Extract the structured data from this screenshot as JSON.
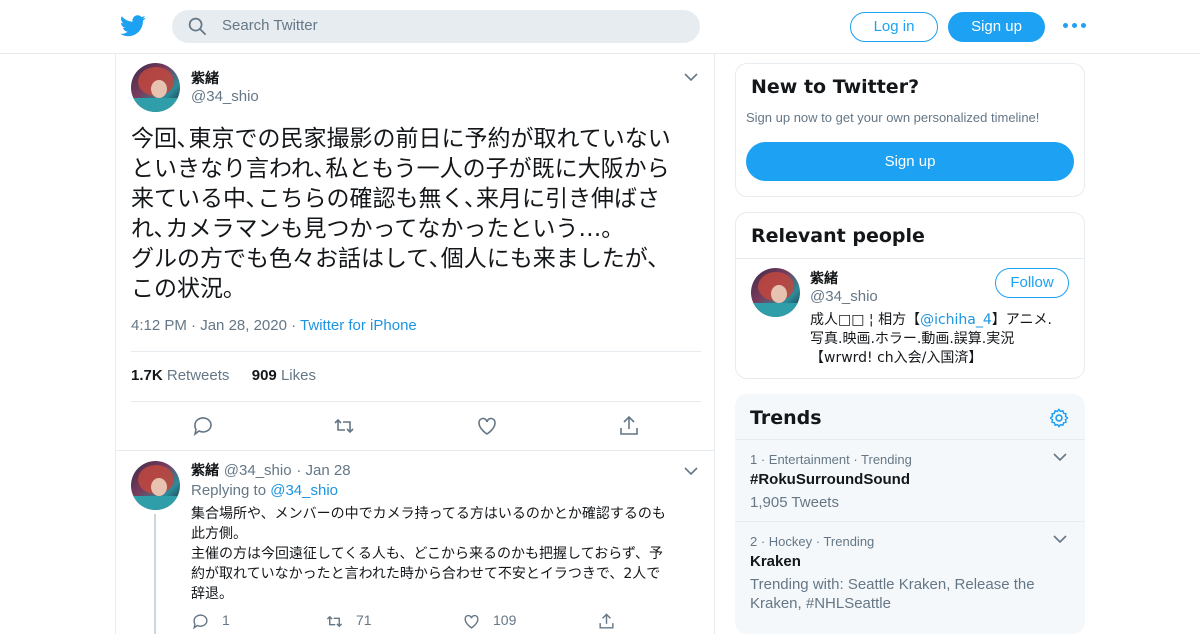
{
  "topbar": {
    "search_placeholder": "Search Twitter",
    "login_label": "Log in",
    "signup_label": "Sign up",
    "brand_color": "#1da1f2"
  },
  "tweet": {
    "name": "紫緒",
    "handle": "@34_shio",
    "text": "今回､東京での民家撮影の前日に予約が取れていない\nといきなり言われ､私ともう一人の子が既に大阪から\n来ている中､こちらの確認も無く､来月に引き伸ばさ\nれ､カメラマンも見つかってなかったという…｡\nグルの方でも色々お話はして､個人にも来ましたが､\nこの状況｡",
    "time": "4:12 PM",
    "date": "Jan 28, 2020",
    "source": "Twitter for iPhone",
    "retweets_count": "1.7K",
    "retweets_label": "Retweets",
    "likes_count": "909",
    "likes_label": "Likes"
  },
  "reply": {
    "name": "紫緒",
    "handle": "@34_shio",
    "date": "Jan 28",
    "replying_prefix": "Replying to",
    "replying_to": "@34_shio",
    "text": "集合場所や、メンバーの中でカメラ持ってる方はいるのかとか確認するのも\n此方側。\n主催の方は今回遠征してくる人も、どこから来るのかも把握しておらず、予\n約が取れていなかったと言われた時から合わせて不安とイラつきで、2人で\n辞退。",
    "reply_count": "1",
    "retweet_count": "71",
    "like_count": "109"
  },
  "new_to_twitter": {
    "title": "New to Twitter?",
    "subtitle": "Sign up now to get your own personalized timeline!",
    "signup_label": "Sign up"
  },
  "relevant_people": {
    "title": "Relevant people",
    "name": "紫緒",
    "handle": "@34_shio",
    "follow_label": "Follow",
    "bio_pre": "成人□□ ¦ 相方【",
    "bio_mention": "@ichiha_4",
    "bio_post": "】アニメ.\n写真.映画.ホラー.動画.誤算.実況\n【wrwrd! ch入会/入国済】"
  },
  "trends": {
    "title": "Trends",
    "items": [
      {
        "context": "1 · Entertainment · Trending",
        "name": "#RokuSurroundSound",
        "sub": "1,905 Tweets"
      },
      {
        "context": "2 · Hockey · Trending",
        "name": "Kraken",
        "sub": "Trending with: Seattle Kraken, Release the Kraken, #NHLSeattle"
      }
    ]
  }
}
